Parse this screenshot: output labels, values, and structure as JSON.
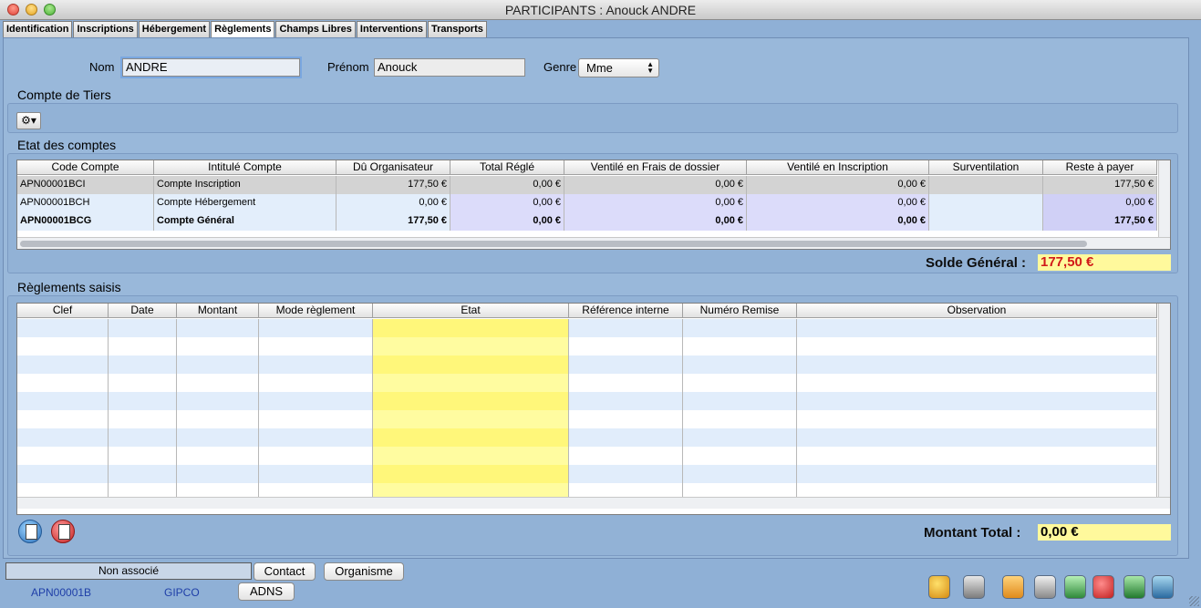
{
  "window": {
    "title": "PARTICIPANTS : Anouck ANDRE"
  },
  "tabs": [
    "Identification",
    "Inscriptions",
    "Hébergement",
    "Règlements",
    "Champs Libres",
    "Interventions",
    "Transports"
  ],
  "active_tab": "Règlements",
  "identity": {
    "nom_label": "Nom",
    "nom_value": "ANDRE",
    "prenom_label": "Prénom",
    "prenom_value": "Anouck",
    "genre_label": "Genre",
    "genre_value": "Mme"
  },
  "compte_tiers": {
    "title": "Compte de Tiers",
    "gear_icon": "gear-icon"
  },
  "etat_comptes": {
    "title": "Etat des comptes",
    "columns": [
      "Code Compte",
      "Intitulé Compte",
      "Dû Organisateur",
      "Total Réglé",
      "Ventilé en Frais de dossier",
      "Ventilé en Inscription",
      "Surventilation",
      "Reste à payer"
    ],
    "rows": [
      {
        "code": "APN00001BCI",
        "intitule": "Compte Inscription",
        "du": "177,50 €",
        "regle": "0,00 €",
        "frais": "0,00 €",
        "inscription": "0,00 €",
        "surv": "",
        "reste": "177,50 €"
      },
      {
        "code": "APN00001BCH",
        "intitule": "Compte Hébergement",
        "du": "0,00 €",
        "regle": "0,00 €",
        "frais": "0,00 €",
        "inscription": "0,00 €",
        "surv": "",
        "reste": "0,00 €"
      },
      {
        "code": "APN00001BCG",
        "intitule": "Compte Général",
        "du": "177,50 €",
        "regle": "0,00 €",
        "frais": "0,00 €",
        "inscription": "0,00 €",
        "surv": "",
        "reste": "177,50 €"
      }
    ],
    "solde_label": "Solde Général :",
    "solde_value": "177,50 €"
  },
  "reglements": {
    "title": "Règlements saisis",
    "columns": [
      "Clef",
      "Date",
      "Montant",
      "Mode règlement",
      "Etat",
      "Référence interne",
      "Numéro Remise",
      "Observation"
    ],
    "total_label": "Montant Total :",
    "total_value": "0,00 €"
  },
  "footer": {
    "association_status": "Non associé",
    "contact_button": "Contact",
    "organisme_button": "Organisme",
    "adns_button": "ADNS",
    "code": "APN00001B",
    "org": "GIPCO"
  },
  "colors": {
    "accent_red": "#d11a1a",
    "highlight_yellow": "#fff99c"
  }
}
